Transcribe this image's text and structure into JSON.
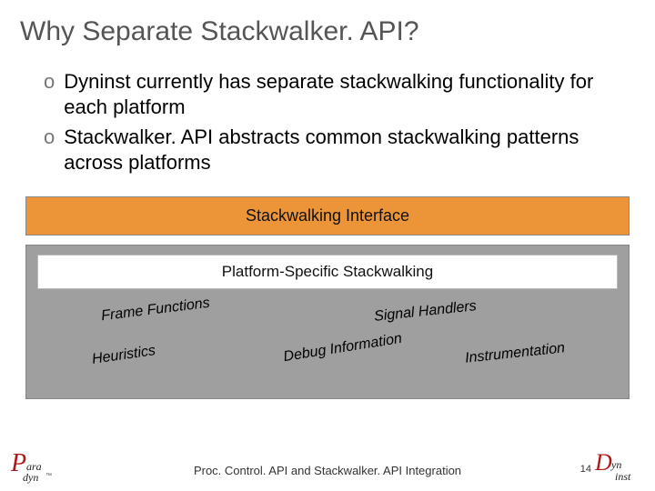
{
  "title": "Why Separate Stackwalker. API?",
  "bullets": [
    "Dyninst currently has separate stackwalking functionality for each platform",
    "Stackwalker. API abstracts common stackwalking patterns across platforms"
  ],
  "boxes": {
    "interface": "Stackwalking Interface",
    "platform_title": "Platform-Specific Stackwalking",
    "items": {
      "frame_functions": "Frame Functions",
      "signal_handlers": "Signal Handlers",
      "heuristics": "Heuristics",
      "debug_info": "Debug Information",
      "instrumentation": "Instrumentation"
    }
  },
  "footer": "Proc. Control. API and Stackwalker. API Integration",
  "page": "14",
  "logos": {
    "paradyn": {
      "p": "P",
      "ara": "ara",
      "dyn": "dyn",
      "tm": "™"
    },
    "dyninst": {
      "d": "D",
      "yn": "yn",
      "inst": "inst"
    }
  }
}
